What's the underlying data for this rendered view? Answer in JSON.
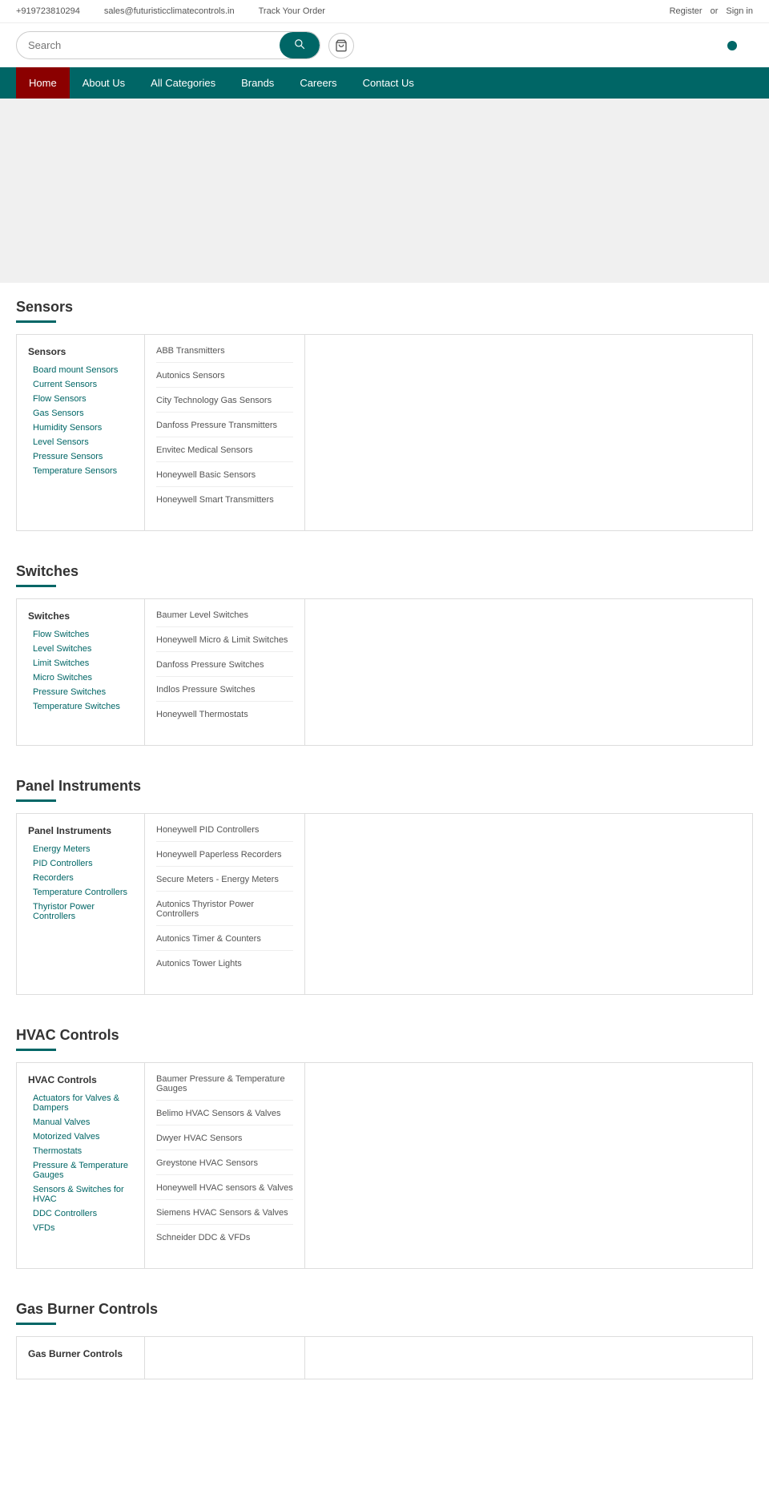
{
  "topbar": {
    "phone": "+919723810294",
    "email": "sales@futuristicclimatecontrols.in",
    "track": "Track Your Order",
    "register": "Register",
    "or": "or",
    "signin": "Sign in"
  },
  "search": {
    "placeholder": "Search",
    "button_label": ""
  },
  "nav": {
    "home": "Home",
    "about": "About Us",
    "categories": "All Categories",
    "brands": "Brands",
    "careers": "Careers",
    "contact": "Contact Us"
  },
  "sections": [
    {
      "id": "sensors",
      "title": "Sensors",
      "col1_title": "Sensors",
      "col1_links": [
        "Board mount Sensors",
        "Current Sensors",
        "Flow Sensors",
        "Gas Sensors",
        "Humidity Sensors",
        "Level Sensors",
        "Pressure Sensors",
        "Temperature Sensors"
      ],
      "col2_links": [
        "ABB Transmitters",
        "Autonics Sensors",
        "City Technology Gas Sensors",
        "Danfoss Pressure Transmitters",
        "Envitec Medical Sensors",
        "Honeywell Basic Sensors",
        "Honeywell Smart Transmitters"
      ]
    },
    {
      "id": "switches",
      "title": "Switches",
      "col1_title": "Switches",
      "col1_links": [
        "Flow Switches",
        "Level Switches",
        "Limit Switches",
        "Micro Switches",
        "Pressure Switches",
        "Temperature Switches"
      ],
      "col2_links": [
        "Baumer Level Switches",
        "Honeywell Micro & Limit Switches",
        "Danfoss Pressure Switches",
        "Indlos Pressure Switches",
        "Honeywell Thermostats"
      ]
    },
    {
      "id": "panel-instruments",
      "title": "Panel Instruments",
      "col1_title": "Panel Instruments",
      "col1_links": [
        "Energy Meters",
        "PID Controllers",
        "Recorders",
        "Temperature Controllers",
        "Thyristor Power Controllers"
      ],
      "col2_links": [
        "Honeywell PID Controllers",
        "Honeywell Paperless Recorders",
        "Secure Meters - Energy Meters",
        "Autonics Thyristor Power Controllers",
        "Autonics Timer & Counters",
        "Autonics Tower Lights"
      ]
    },
    {
      "id": "hvac-controls",
      "title": "HVAC Controls",
      "col1_title": "HVAC Controls",
      "col1_links": [
        "Actuators for Valves & Dampers",
        "Manual Valves",
        "Motorized Valves",
        "Thermostats",
        "Pressure & Temperature Gauges",
        "Sensors & Switches for HVAC",
        "DDC Controllers",
        "VFDs"
      ],
      "col2_links": [
        "Baumer Pressure & Temperature Gauges",
        "Belimo HVAC Sensors & Valves",
        "Dwyer HVAC Sensors",
        "Greystone HVAC Sensors",
        "Honeywell HVAC sensors & Valves",
        "Siemens HVAC Sensors & Valves",
        "Schneider DDC & VFDs"
      ]
    },
    {
      "id": "gas-burner-controls",
      "title": "Gas Burner Controls",
      "col1_title": "Gas Burner Controls",
      "col1_links": [],
      "col2_links": []
    }
  ]
}
